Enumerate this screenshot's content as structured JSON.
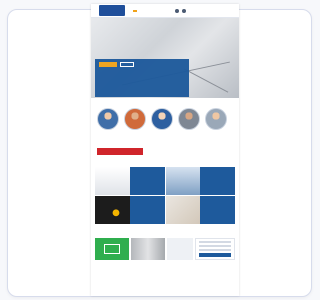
{
  "colors": {
    "brand_blue": "#1f4f9b",
    "accent_orange": "#f0a21a",
    "banner_red": "#d0252b",
    "exit_green": "#2fae4e"
  },
  "site": {
    "logo_label": "",
    "nav_items": [
      "",
      "",
      "",
      "",
      "",
      ""
    ]
  },
  "hero": {
    "heading": "",
    "body": ""
  },
  "team": {
    "kicker": "",
    "heading": ""
  },
  "banner": {
    "line1": "",
    "line2": ""
  },
  "services": {
    "heading": ""
  },
  "bottom": {
    "heading": ""
  }
}
